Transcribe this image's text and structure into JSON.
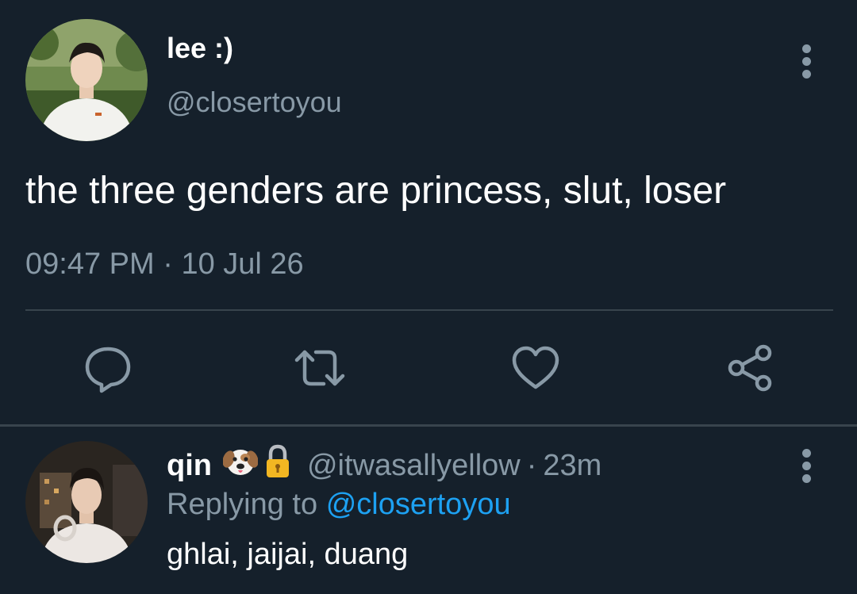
{
  "main_tweet": {
    "author_name": "lee :)",
    "author_handle": "@closertoyou",
    "text": "the three genders are princess, slut, loser",
    "time": "09:47 PM",
    "separator": "·",
    "date": "10 Jul 26",
    "actions": [
      "reply-icon",
      "retweet-icon",
      "like-icon",
      "share-icon"
    ]
  },
  "reply": {
    "author_name": "qin",
    "badges": [
      "dog-face-emoji",
      "lock-emoji"
    ],
    "author_handle": "@itwasallyellow",
    "separator": "·",
    "time_ago": "23m",
    "replying_prefix": "Replying to",
    "replying_handle": "@closertoyou",
    "text": "ghlai, jaijai, duang"
  },
  "colors": {
    "background": "#15202b",
    "primary_text": "#ffffff",
    "secondary_text": "#8899a6",
    "link": "#1da1f2",
    "divider": "#38444d"
  }
}
